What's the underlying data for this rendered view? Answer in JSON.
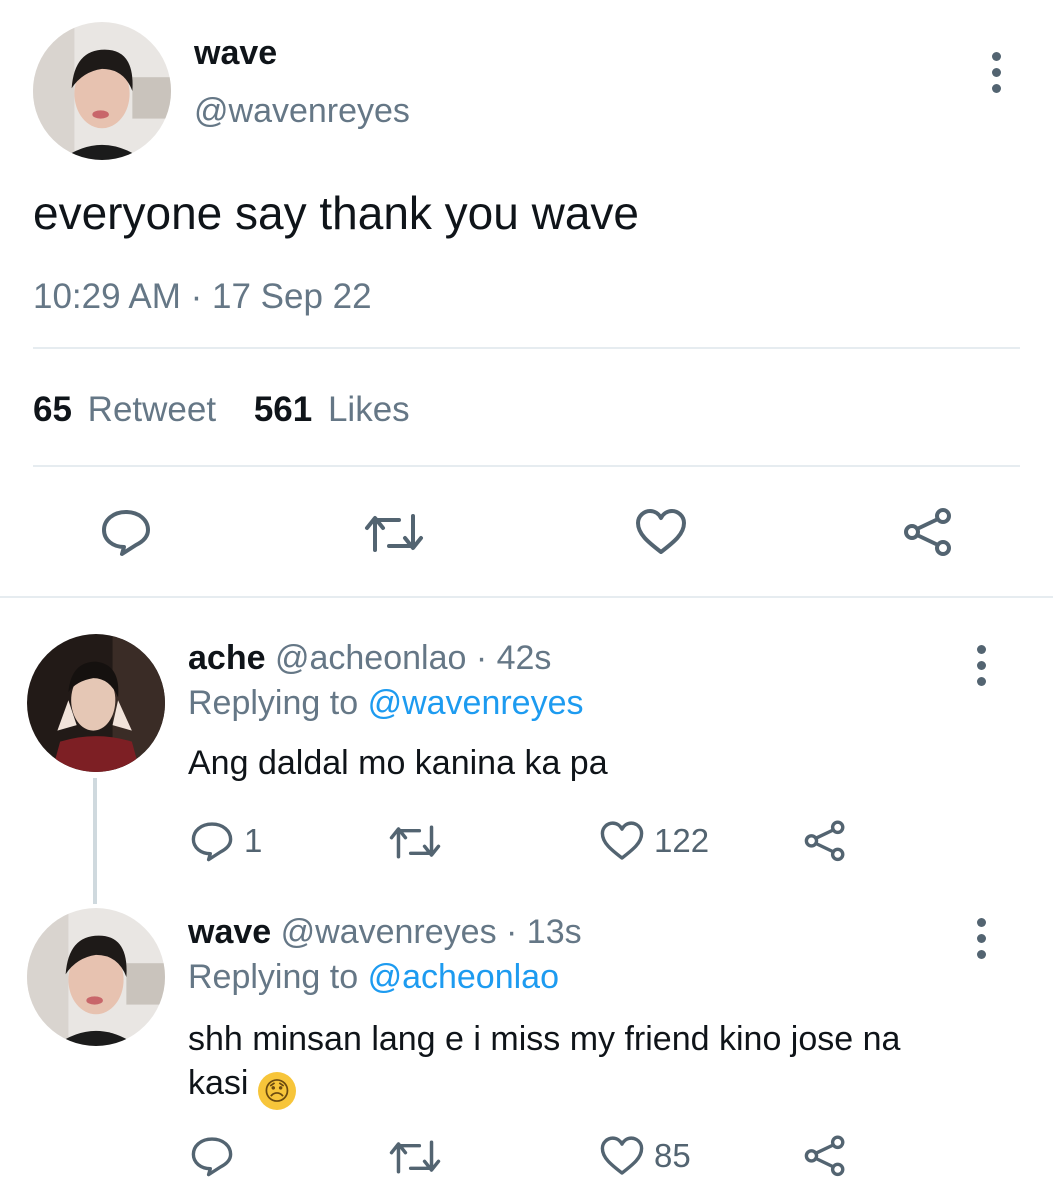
{
  "main_tweet": {
    "display_name": "wave",
    "handle": "@wavenreyes",
    "text": "everyone say thank you wave",
    "timestamp": "10:29 AM · 17 Sep 22",
    "retweet_count": "65",
    "retweet_label": "Retweet",
    "like_count": "561",
    "like_label": "Likes"
  },
  "replies": [
    {
      "display_name": "ache",
      "handle": "@acheonlao",
      "time": "· 42s",
      "replying_label": "Replying to",
      "replying_to": "@wavenreyes",
      "text": "Ang daldal mo kanina ka pa",
      "reply_count": "1",
      "retweet_count": "",
      "like_count": "122"
    },
    {
      "display_name": "wave",
      "handle": "@wavenreyes",
      "time": "· 13s",
      "replying_label": "Replying to",
      "replying_to": "@acheonlao",
      "text_line1": "shh minsan lang e i miss my friend kino jose na",
      "text_line2": "kasi",
      "emoji": "😞",
      "reply_count": "",
      "retweet_count": "",
      "like_count": "85"
    }
  ],
  "icons": {
    "reply": "reply-bubble-icon",
    "retweet": "retweet-icon",
    "like": "heart-icon",
    "share": "share-icon",
    "more": "more-options-icon"
  },
  "colors": {
    "text": "#0f1419",
    "secondary": "#657786",
    "link": "#1d9bf0",
    "divider": "#e6ecf0"
  }
}
